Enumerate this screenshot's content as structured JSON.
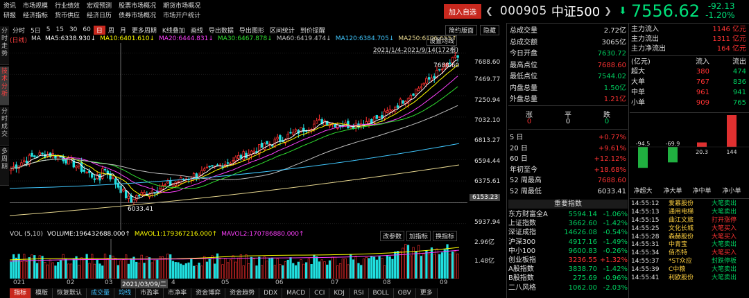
{
  "menu_row1": [
    "资讯",
    "市场规模",
    "行业绩效",
    "宏观预测",
    "股票市场概况",
    "期货市场概况"
  ],
  "menu_row2": [
    "研报",
    "经济指标",
    "货币供应",
    "经济日历",
    "债券市场概况",
    "市场开户统计"
  ],
  "header": {
    "add_watch": "加入自选",
    "code": "000905",
    "name": "中证500",
    "price": "7556.62",
    "change": "-92.13",
    "change_pct": "-1.20%"
  },
  "side_tabs": [
    "分时走势",
    "技术分析",
    "分时成交",
    "多周期"
  ],
  "toolbar": [
    "分时",
    "5日",
    "5",
    "15",
    "30",
    "60",
    "日",
    "周",
    "月",
    "更多周期",
    "K线叠加",
    "画线",
    "导出数据",
    "导出图形",
    "区间统计",
    "到价提醒"
  ],
  "toolbar_right": [
    "简约版面",
    "隐藏"
  ],
  "ma_line": {
    "prefix": "(日线)",
    "ma": "MA",
    "ma5": "MA5:6338.930↓",
    "ma10": "MA10:6401.610↓",
    "ma20": "MA20:6444.831↓",
    "ma30": "MA30:6467.878↓",
    "ma60": "MA60:6419.474↓",
    "ma120": "MA120:6384.705↓",
    "ma250": "MA250:6106.655↑",
    "set_ma": "设置均线"
  },
  "date_range": "2021/1/4-2021/9/14(172根)",
  "high_label": "7688.60",
  "low_label": "6033.41",
  "cursor_price": "6153.23",
  "y_axis": [
    "7688.60",
    "7469.77",
    "7250.94",
    "7032.10",
    "6813.27",
    "6594.44",
    "6375.61",
    "6153.23",
    "5937.94"
  ],
  "vol_axis": [
    "2.96亿",
    "1.48亿"
  ],
  "vol_line": {
    "vol": "VOL (5,10)",
    "volume": "VOLUME:196432688.000↑",
    "mavol1": "MAVOL1:179367216.000↑",
    "mavol2": "MAVOL2:170786880.000↑"
  },
  "vol_buttons": [
    "改参数",
    "加指标",
    "换指标"
  ],
  "x_axis": [
    "021",
    "02",
    "03",
    "2021/03/09/二",
    "4",
    "05",
    "06",
    "07",
    "08",
    "09"
  ],
  "bottom_tabs": [
    "指标",
    "模版",
    "恢复默认",
    "成交量",
    "均线",
    "市盈率",
    "市净率",
    "资金博弈",
    "资金趋势",
    "DDX",
    "MACD",
    "CCI",
    "KDJ",
    "RSI",
    "BOLL",
    "OBV",
    "更多"
  ],
  "quote": [
    {
      "label": "总成交量",
      "value": "2.72亿",
      "color": "white"
    },
    {
      "label": "总成交额",
      "value": "3065亿",
      "color": "white"
    },
    {
      "label": "今日开盘",
      "value": "7630.72",
      "color": "green"
    },
    {
      "label": "最高点位",
      "value": "7688.60",
      "color": "red"
    },
    {
      "label": "最低点位",
      "value": "7544.02",
      "color": "green"
    },
    {
      "label": "内盘总量",
      "value": "1.50亿",
      "color": "green"
    },
    {
      "label": "外盘总量",
      "value": "1.21亿",
      "color": "red"
    }
  ],
  "breadth": {
    "labels": [
      "涨",
      "平",
      "跌"
    ],
    "values": [
      "0",
      "0",
      "0"
    ]
  },
  "periods": [
    {
      "label": "5 日",
      "value": "+0.77%",
      "color": "red"
    },
    {
      "label": "20 日",
      "value": "+9.61%",
      "color": "red"
    },
    {
      "label": "60 日",
      "value": "+12.12%",
      "color": "red"
    },
    {
      "label": "年初至今",
      "value": "+18.68%",
      "color": "red"
    },
    {
      "label": "52 周最高",
      "value": "7688.60",
      "color": "red"
    },
    {
      "label": "52 周最低",
      "value": "6033.41",
      "color": "white"
    }
  ],
  "index_title": "重要指数",
  "indices": [
    {
      "name": "东方财富全A",
      "value": "5594.14",
      "pct": "-1.06%",
      "color": "green"
    },
    {
      "name": "上证指数",
      "value": "3662.60",
      "pct": "-1.42%",
      "color": "green"
    },
    {
      "name": "深证成指",
      "value": "14626.08",
      "pct": "-0.54%",
      "color": "green"
    },
    {
      "name": "沪深300",
      "value": "4917.16",
      "pct": "-1.49%",
      "color": "green"
    },
    {
      "name": "中小100",
      "value": "9600.83",
      "pct": "-0.26%",
      "color": "green"
    },
    {
      "name": "创业板指",
      "value": "3236.55",
      "pct": "+1.32%",
      "color": "red"
    },
    {
      "name": "A股指数",
      "value": "3838.70",
      "pct": "-1.42%",
      "color": "green"
    },
    {
      "name": "B股指数",
      "value": "275.69",
      "pct": "-0.96%",
      "color": "green"
    },
    {
      "name": "二八风格",
      "value": "1062.00",
      "pct": "-2.03%",
      "color": "green"
    }
  ],
  "flow_summary": [
    {
      "label": "主力流入",
      "value": "1146 亿元"
    },
    {
      "label": "主力流出",
      "value": "1311 亿元"
    },
    {
      "label": "主力净流出",
      "value": "164 亿元"
    }
  ],
  "flow_table": {
    "headers": [
      "(亿元)",
      "流入",
      "流出"
    ],
    "rows": [
      {
        "label": "超大",
        "in": "380",
        "out": "474"
      },
      {
        "label": "大单",
        "in": "767",
        "out": "836"
      },
      {
        "label": "中单",
        "in": "961",
        "out": "941"
      },
      {
        "label": "小单",
        "in": "909",
        "out": "765"
      }
    ]
  },
  "flow_chart": {
    "type": "bar",
    "categories": [
      "净超大",
      "净大单",
      "净中单",
      "净小单"
    ],
    "values": [
      -94.5,
      -69.9,
      20.3,
      144
    ],
    "labels": [
      "-94.5",
      "-69.9",
      "20.3",
      "144"
    ]
  },
  "trades": [
    {
      "time": "14:55:12",
      "stock": "爱慕股份",
      "action": "大笔卖出",
      "color": "green"
    },
    {
      "time": "14:55:13",
      "stock": "通用电梯",
      "action": "大笔卖出",
      "color": "green"
    },
    {
      "time": "14:55:15",
      "stock": "曲江文旅",
      "action": "打开涨停",
      "color": "red"
    },
    {
      "time": "14:55:25",
      "stock": "文化长城",
      "action": "大笔买入",
      "color": "red"
    },
    {
      "time": "14:55:28",
      "stock": "森赫股份",
      "action": "大笔买入",
      "color": "red"
    },
    {
      "time": "14:55:31",
      "stock": "中青宝",
      "action": "大笔卖出",
      "color": "green"
    },
    {
      "time": "14:55:34",
      "stock": "佰杰特",
      "action": "大笔买入",
      "color": "red"
    },
    {
      "time": "14:55:37",
      "stock": "*ST众应",
      "action": "封跌停板",
      "color": "green"
    },
    {
      "time": "14:55:39",
      "stock": "C中粮",
      "action": "大笔卖出",
      "color": "green"
    },
    {
      "time": "14:55:41",
      "stock": "利欧股份",
      "action": "大笔卖出",
      "color": "green"
    }
  ]
}
